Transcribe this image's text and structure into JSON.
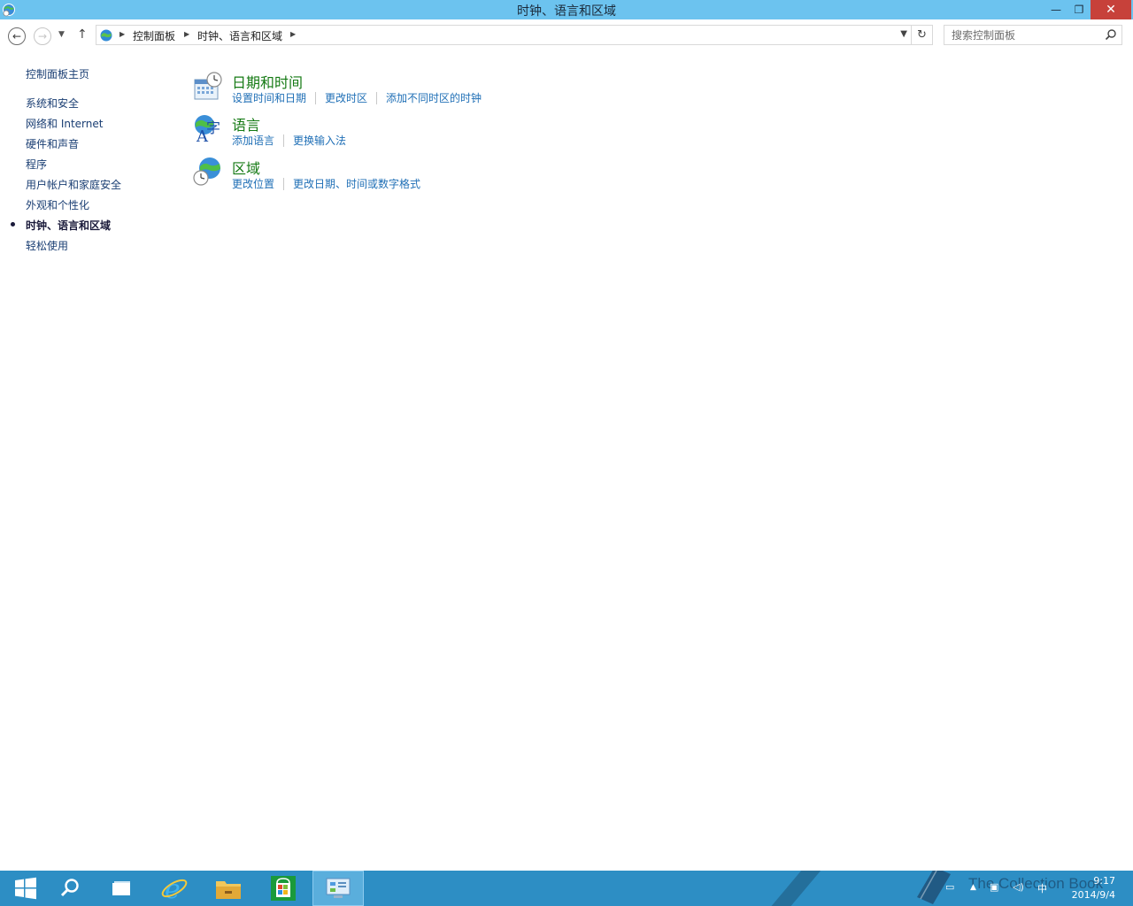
{
  "window": {
    "title": "时钟、语言和区域",
    "minimize": "—",
    "maximize": "❐",
    "close": "✕"
  },
  "address": {
    "crumbs": [
      "控制面板",
      "时钟、语言和区域"
    ],
    "search_placeholder": "搜索控制面板"
  },
  "leftnav": {
    "home": "控制面板主页",
    "items": [
      {
        "label": "系统和安全"
      },
      {
        "label": "网络和 Internet"
      },
      {
        "label": "硬件和声音"
      },
      {
        "label": "程序"
      },
      {
        "label": "用户帐户和家庭安全"
      },
      {
        "label": "外观和个性化"
      },
      {
        "label": "时钟、语言和区域",
        "current": true
      },
      {
        "label": "轻松使用"
      }
    ]
  },
  "categories": [
    {
      "title": "日期和时间",
      "icon": "calendar-clock-icon",
      "links": [
        "设置时间和日期",
        "更改时区",
        "添加不同时区的时钟"
      ]
    },
    {
      "title": "语言",
      "icon": "language-icon",
      "links": [
        "添加语言",
        "更换输入法"
      ]
    },
    {
      "title": "区域",
      "icon": "globe-clock-icon",
      "links": [
        "更改位置",
        "更改日期、时间或数字格式"
      ]
    }
  ],
  "taskbar": {
    "time": "9:17",
    "date": "2014/9/4",
    "ime": "中",
    "watermark": "The Collection Book"
  },
  "colors": {
    "titlebar": "#6cc3ef",
    "taskbar": "#2d8ec4",
    "category_title": "#157a14",
    "link": "#1f6fb6"
  }
}
